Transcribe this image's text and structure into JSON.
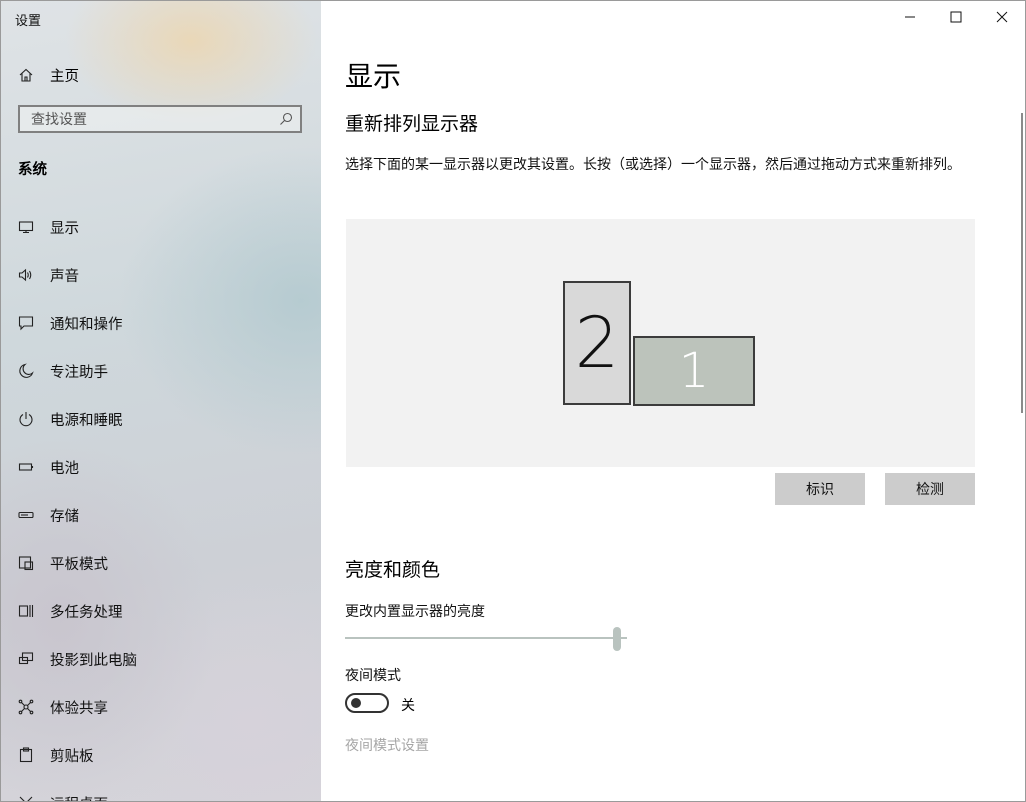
{
  "window": {
    "title": "设置",
    "controls": [
      "minimize-icon",
      "maximize-icon",
      "close-icon"
    ]
  },
  "sidebar": {
    "home_label": "主页",
    "search": {
      "placeholder": "查找设置",
      "value": ""
    },
    "section_title": "系统",
    "selected_index": 0,
    "items": [
      {
        "label": "显示",
        "icon": "monitor-icon"
      },
      {
        "label": "声音",
        "icon": "speaker-icon"
      },
      {
        "label": "通知和操作",
        "icon": "notification-icon"
      },
      {
        "label": "专注助手",
        "icon": "moon-icon"
      },
      {
        "label": "电源和睡眠",
        "icon": "power-icon"
      },
      {
        "label": "电池",
        "icon": "battery-icon"
      },
      {
        "label": "存储",
        "icon": "storage-icon"
      },
      {
        "label": "平板模式",
        "icon": "tablet-mode-icon"
      },
      {
        "label": "多任务处理",
        "icon": "multitasking-icon"
      },
      {
        "label": "投影到此电脑",
        "icon": "projecting-icon"
      },
      {
        "label": "体验共享",
        "icon": "shared-experiences-icon"
      },
      {
        "label": "剪贴板",
        "icon": "clipboard-icon"
      },
      {
        "label": "远程桌面",
        "icon": "remote-desktop-icon"
      }
    ]
  },
  "main": {
    "page_title": "显示",
    "rearrange": {
      "heading": "重新排列显示器",
      "description": "选择下面的某一显示器以更改其设置。长按（或选择）一个显示器，然后通过拖动方式来重新排列。",
      "monitors": [
        {
          "number": "2",
          "selected": false
        },
        {
          "number": "1",
          "selected": true
        }
      ],
      "identify_button": "标识",
      "detect_button": "检测"
    },
    "brightness": {
      "heading": "亮度和颜色",
      "slider_label": "更改内置显示器的亮度",
      "value_percent": 100,
      "night_light_label": "夜间模式",
      "night_light_on": false,
      "night_light_state": "关",
      "night_light_settings": "夜间模式设置"
    }
  }
}
